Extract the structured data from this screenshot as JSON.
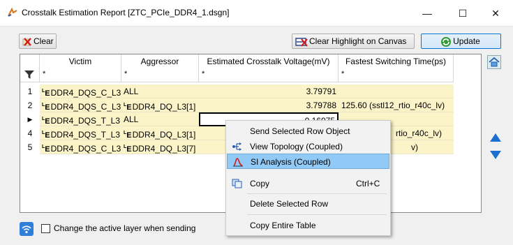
{
  "window": {
    "title": "Crosstalk Estimation Report [ZTC_PCIe_DDR4_1.dsgn]",
    "minimize": "—",
    "maximize": "☐",
    "close": "✕"
  },
  "toolbar": {
    "clear_label": "Clear",
    "clear_highlight_label": "Clear Highlight on Canvas",
    "update_label": "Update"
  },
  "table": {
    "columns": [
      "Victim",
      "Aggressor",
      "Estimated Crosstalk Voltage(mV)",
      "Fastest Switching Time(ps)"
    ],
    "filter_placeholder": "*",
    "net_prefix": "E",
    "net_prefix_mark": "L",
    "rows": [
      {
        "index": "1",
        "victim": "DDR4_DQS_C_L3",
        "aggressor": "ALL",
        "aggressor_is_net": false,
        "voltage": "3.79791",
        "time": ""
      },
      {
        "index": "2",
        "victim": "DDR4_DQS_C_L3",
        "aggressor": "DDR4_DQ_L3[1]",
        "aggressor_is_net": true,
        "voltage": "3.79788",
        "time": "125.60 (sstl12_rtio_r40c_lv)"
      },
      {
        "index": "▶",
        "victim": "DDR4_DQS_T_L3",
        "aggressor": "ALL",
        "aggressor_is_net": false,
        "voltage": "0.16075",
        "time": ""
      },
      {
        "index": "4",
        "victim": "DDR4_DQS_T_L3",
        "aggressor": "DDR4_DQ_L3[1]",
        "aggressor_is_net": true,
        "voltage": "",
        "time": "rtio_r40c_lv)"
      },
      {
        "index": "5",
        "victim": "DDR4_DQS_C_L3",
        "aggressor": "DDR4_DQ_L3[7]",
        "aggressor_is_net": true,
        "voltage": "",
        "time": "v)"
      }
    ]
  },
  "bottom": {
    "checkbox_label": "Change the active layer when sending",
    "checked": false
  },
  "context_menu": {
    "items": [
      {
        "label": "Send Selected Row Object",
        "shortcut": "",
        "icon": "",
        "highlighted": false
      },
      {
        "label": "View Topology (Coupled)",
        "shortcut": "",
        "icon": "topology-icon",
        "highlighted": false
      },
      {
        "label": "SI Analysis (Coupled)",
        "shortcut": "",
        "icon": "si-analysis-icon",
        "highlighted": true
      },
      {
        "label": "Copy",
        "shortcut": "Ctrl+C",
        "icon": "copy-icon",
        "highlighted": false
      },
      {
        "label": "Delete Selected Row",
        "shortcut": "",
        "icon": "",
        "highlighted": false
      },
      {
        "label": "Copy Entire Table",
        "shortcut": "",
        "icon": "",
        "highlighted": false
      }
    ]
  },
  "colors": {
    "row_fill": "#fbf4c8",
    "menu_highlight": "#91c9f7",
    "update_border": "#0078d7"
  }
}
